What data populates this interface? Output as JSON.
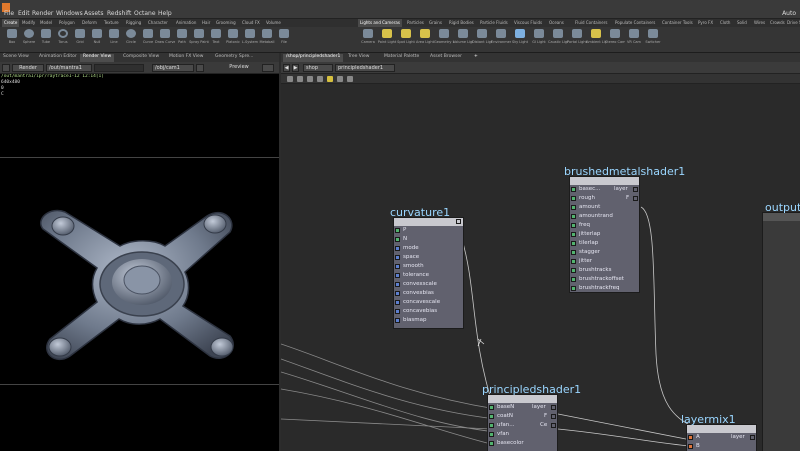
{
  "menu": [
    "File",
    "Edit",
    "Render",
    "Windows",
    "Assets",
    "Redshift",
    "Octane",
    "Help"
  ],
  "menu_right": "Auto",
  "shelf_tabs_left": [
    "Create",
    "Modify",
    "Model",
    "Polygon",
    "Deform",
    "Texture",
    "Rigging",
    "Character",
    "Animation",
    "Hair",
    "Grooming",
    "Cloud FX",
    "Volume"
  ],
  "shelf_tabs_right": [
    "Lights and Cameras",
    "Particles",
    "Grains",
    "Rigid Bodies",
    "Particle Fluids",
    "Viscous Fluids",
    "Oceans",
    "Fluid Containers",
    "Populate Containers",
    "Container Tools",
    "Pyro FX",
    "Cloth",
    "Solid",
    "Wires",
    "Crowds",
    "Drive Sim"
  ],
  "tools_left": [
    "Box",
    "Sphere",
    "Tube",
    "Torus",
    "Grid",
    "Null",
    "Line",
    "Circle",
    "Curve",
    "Draw Curve",
    "Path",
    "Spray Paint",
    "Text",
    "Platonic",
    "L-System",
    "Metaball",
    "File"
  ],
  "tools_right": [
    "Camera",
    "Point Light",
    "Spot Light",
    "Area Light",
    "Geometry Light",
    "Volume Light",
    "Distant Light",
    "Environment",
    "Sky Light",
    "GI Light",
    "Caustic Light",
    "Portal Light",
    "Ambient Light",
    "Stereo Cam",
    "VR Cam",
    "Switcher"
  ],
  "left_tabs": [
    "Scene View",
    "Animation Editor",
    "Render View",
    "Composite View",
    "Motion FX View",
    "Geometry Spre..."
  ],
  "left_bar": {
    "render_btn": "Render",
    "rop": "/out/mantra1",
    "cam": "/obj/cam1",
    "preview": "Preview"
  },
  "render_text": [
    "/out/mantra1/ipr/raytrace1-12 12:14[1]",
    "640x480",
    "0",
    "C"
  ],
  "right_tabs": [
    "/shop/principledshader1",
    "Tree View",
    "Material Palette",
    "Asset Browser"
  ],
  "path": [
    "shop",
    "principledshader1"
  ],
  "nodes": {
    "curvature": {
      "title": "curvature1",
      "ports": [
        "P",
        "N",
        "mode",
        "space",
        "smooth",
        "tolerance",
        "convexscale",
        "convexbias",
        "concavescale",
        "concavebias",
        "biasmap"
      ]
    },
    "brushed": {
      "title": "brushedmetalshader1",
      "ports": [
        "basec...",
        "rough",
        "amount",
        "amountrand",
        "freq",
        "jitterlap",
        "tilerlap",
        "stagger",
        "jitter",
        "brushtracks",
        "brushtrackoffset",
        "brushtrackfreq"
      ],
      "outs": [
        "layer",
        "F"
      ]
    },
    "principled": {
      "title": "principledshader1",
      "ports": [
        "baseN",
        "coatN",
        "ufan...",
        "vfan",
        "basecolor"
      ],
      "outs": [
        "layer",
        "F",
        "Ce"
      ]
    },
    "layermix": {
      "title": "layermix1",
      "ports": [
        "A",
        "B"
      ],
      "outs": [
        "layer"
      ]
    },
    "output": {
      "title": "output"
    }
  }
}
